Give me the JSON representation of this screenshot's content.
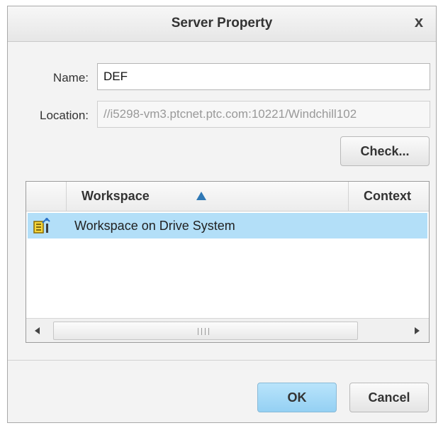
{
  "dialog": {
    "title": "Server Property",
    "close_symbol": "x"
  },
  "form": {
    "name_label": "Name:",
    "name_value": "DEF",
    "location_label": "Location:",
    "location_value": "//i5298-vm3.ptcnet.ptc.com:10221/Windchill102",
    "check_label": "Check..."
  },
  "table": {
    "columns": [
      "Workspace",
      "Context"
    ],
    "sorted_column": "Workspace",
    "sort_direction": "ascending",
    "rows": [
      {
        "icon": "workspace-icon",
        "workspace": "Workspace on Drive System",
        "context": "",
        "selected": true
      }
    ],
    "scrollbar_grip": "IIII"
  },
  "buttons": {
    "ok": "OK",
    "cancel": "Cancel"
  },
  "colors": {
    "selection": "#b3dff8",
    "primary_button": "#a6daf6",
    "sort_arrow": "#2f78b5"
  }
}
